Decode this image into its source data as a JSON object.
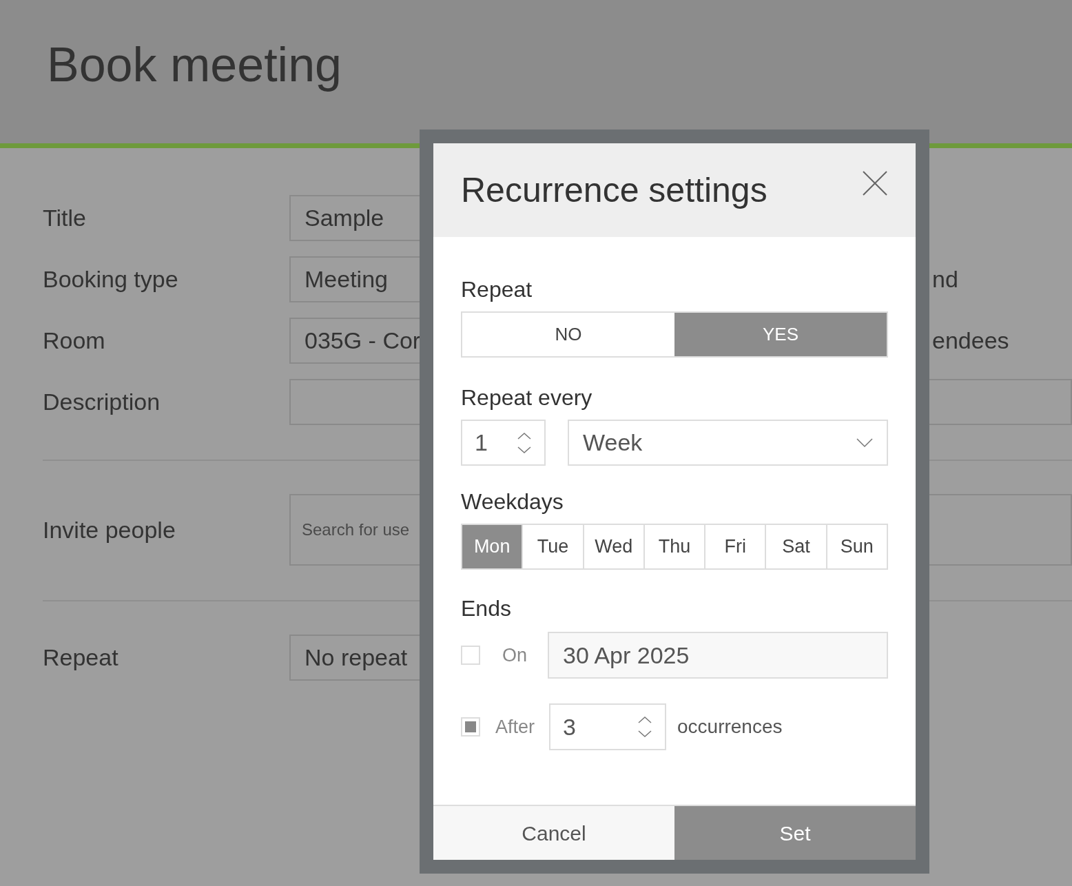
{
  "page": {
    "title": "Book meeting",
    "sections": [
      [
        {
          "kind": "short",
          "label": "Title",
          "value": "Sample"
        },
        {
          "kind": "short",
          "label": "Booking type",
          "value": "Meeting",
          "side_label": "nd"
        },
        {
          "kind": "short",
          "label": "Room",
          "value": "035G - Cor",
          "side_label": "endees"
        },
        {
          "kind": "wide",
          "label": "Description"
        }
      ],
      [
        {
          "kind": "area",
          "label": "Invite people",
          "placeholder": "Search for use"
        }
      ],
      [
        {
          "kind": "short",
          "label": "Repeat",
          "value": "No repeat"
        }
      ]
    ]
  },
  "dialog": {
    "title": "Recurrence settings",
    "repeat": {
      "label": "Repeat",
      "options": [
        {
          "label": "NO",
          "selected": false
        },
        {
          "label": "YES",
          "selected": true
        }
      ]
    },
    "repeat_every": {
      "label": "Repeat every",
      "value": "1",
      "unit": "Week"
    },
    "weekdays": {
      "label": "Weekdays",
      "days": [
        {
          "label": "Mon",
          "selected": true
        },
        {
          "label": "Tue",
          "selected": false
        },
        {
          "label": "Wed",
          "selected": false
        },
        {
          "label": "Thu",
          "selected": false
        },
        {
          "label": "Fri",
          "selected": false
        },
        {
          "label": "Sat",
          "selected": false
        },
        {
          "label": "Sun",
          "selected": false
        }
      ]
    },
    "ends": {
      "label": "Ends",
      "options": [
        {
          "kind": "date",
          "label": "On",
          "checked": false,
          "value": "30 Apr 2025"
        },
        {
          "kind": "count",
          "label": "After",
          "checked": true,
          "value": "3",
          "suffix": "occurrences"
        }
      ]
    },
    "buttons": [
      {
        "label": "Cancel",
        "primary": false
      },
      {
        "label": "Set",
        "primary": true
      }
    ]
  }
}
